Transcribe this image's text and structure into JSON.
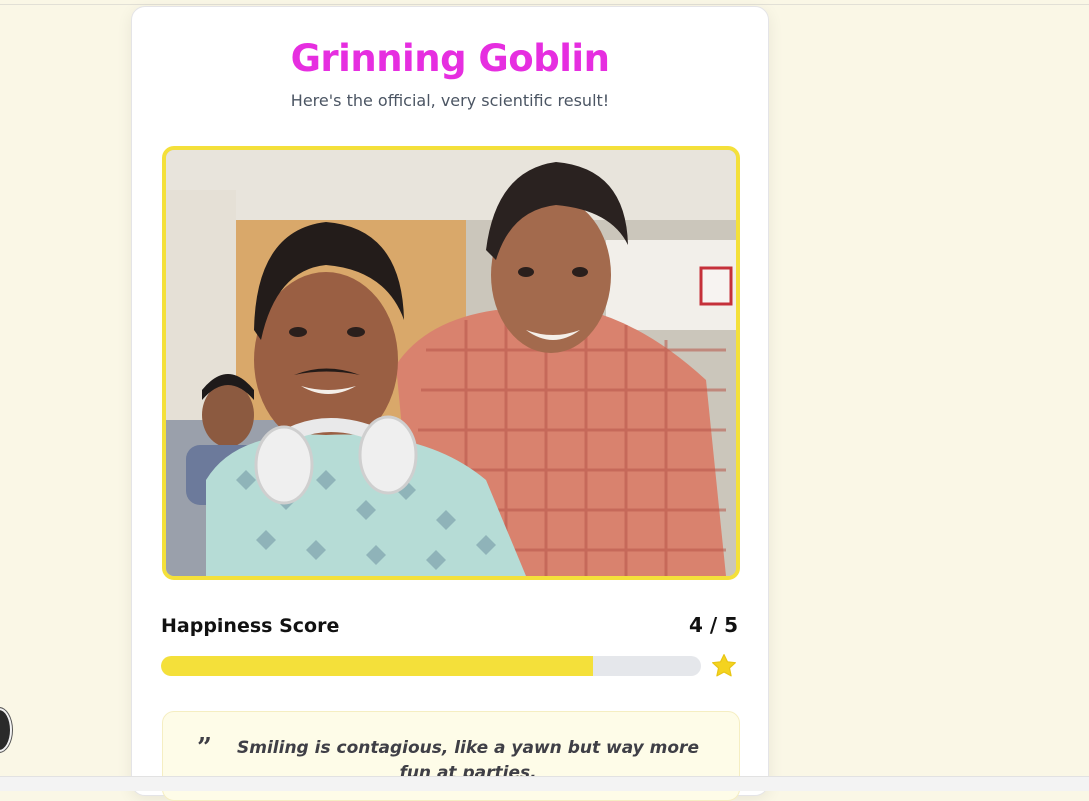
{
  "result": {
    "title": "Grinning Goblin",
    "subtitle": "Here's the official, very scientific result!",
    "photo_alt": "Selfie of two smiling friends"
  },
  "score": {
    "label": "Happiness Score",
    "value_text": "4 / 5",
    "value": 4,
    "max": 5,
    "fill_fraction": 0.8,
    "star_icon": "star-icon"
  },
  "quote": {
    "icon": "quote-icon",
    "text": "Smiling is contagious, like a yawn but way more fun at parties."
  },
  "colors": {
    "title": "#e62ee0",
    "accent_yellow": "#f4e03a",
    "page_background": "#faf7e6",
    "quote_background": "#fefce8"
  }
}
